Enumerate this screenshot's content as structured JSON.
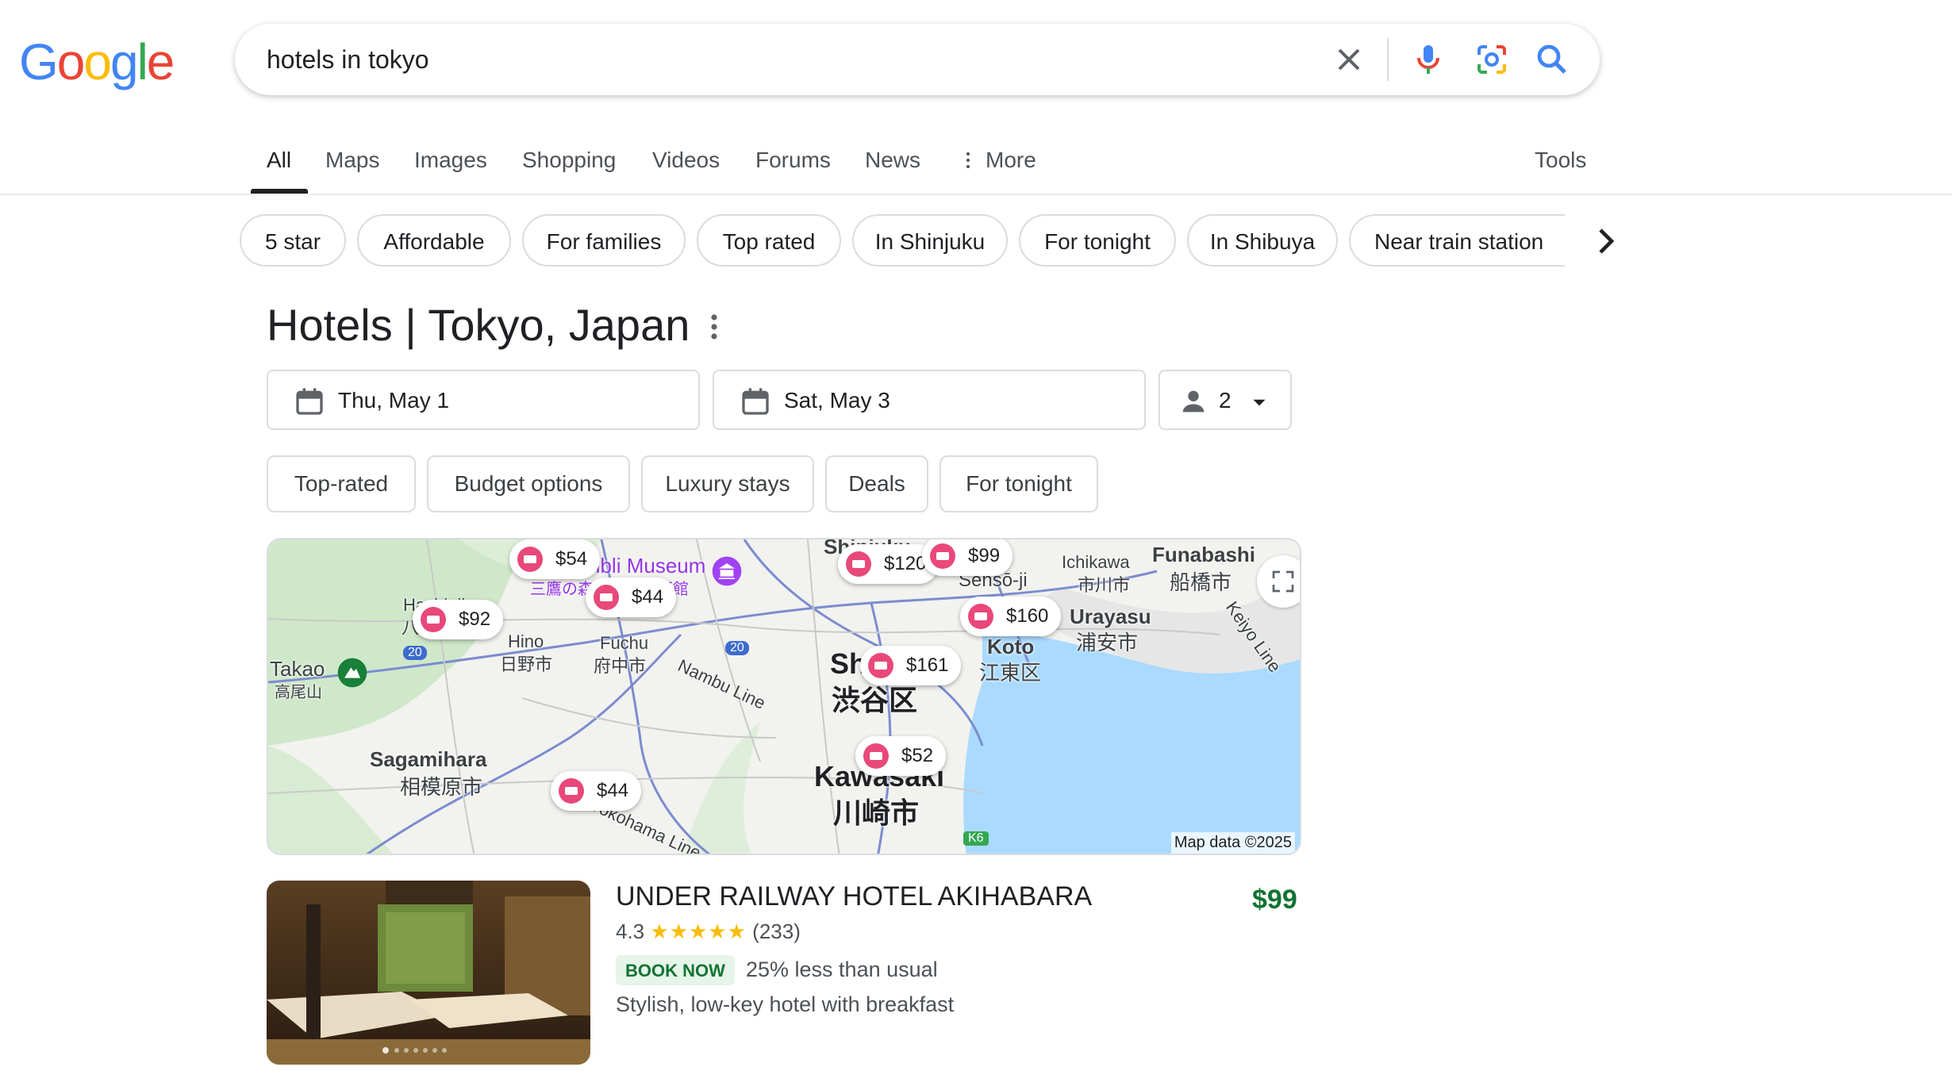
{
  "logo": {
    "letters": [
      "G",
      "o",
      "o",
      "g",
      "l",
      "e"
    ],
    "colors": [
      "#4285F4",
      "#EA4335",
      "#FBBC05",
      "#4285F4",
      "#34A853",
      "#EA4335"
    ]
  },
  "search": {
    "query": "hotels in tokyo"
  },
  "tabs": [
    {
      "label": "All",
      "active": true
    },
    {
      "label": "Maps"
    },
    {
      "label": "Images"
    },
    {
      "label": "Shopping"
    },
    {
      "label": "Videos"
    },
    {
      "label": "Forums"
    },
    {
      "label": "News"
    },
    {
      "label": "More"
    }
  ],
  "tools_label": "Tools",
  "chips": [
    "5 star",
    "Affordable",
    "For families",
    "Top rated",
    "In Shinjuku",
    "For tonight",
    "In Shibuya",
    "Near train station"
  ],
  "hotels": {
    "heading": "Hotels | Tokyo, Japan",
    "check_in": "Thu, May 1",
    "check_out": "Sat, May 3",
    "guests": "2",
    "filters": [
      "Top-rated",
      "Budget options",
      "Luxury stays",
      "Deals",
      "For tonight"
    ]
  },
  "map": {
    "attribution": "Map data ©2025",
    "places": [
      "Ghibli Museum",
      "三鷹の森ジブリ美術館",
      "Hachioji",
      "八王子市",
      "Hino",
      "日野市",
      "Fuchu",
      "府中市",
      "Takao",
      "高尾山",
      "Sagamihara",
      "相模原市",
      "Shinjuku",
      "Sensō-ji",
      "Ichikawa",
      "市川市",
      "Funabashi",
      "船橋市",
      "Urayasu",
      "浦安市",
      "Koto",
      "江東区",
      "Shibuya",
      "渋谷区",
      "Kawasaki",
      "川崎市",
      "Nambu Line",
      "Yokohama Line",
      "Keiyo Line",
      "20",
      "K6"
    ],
    "pins": [
      "$54",
      "$44",
      "$92",
      "$120",
      "$99",
      "$160",
      "$161",
      "$52",
      "$44"
    ]
  },
  "result": {
    "name": "UNDER RAILWAY HOTEL AKIHABARA",
    "price": "$99",
    "rating": "4.3",
    "stars": "★★★★★",
    "reviews": "(233)",
    "badge": "BOOK NOW",
    "deal": "25% less than usual",
    "description": "Stylish, low-key hotel with breakfast"
  }
}
